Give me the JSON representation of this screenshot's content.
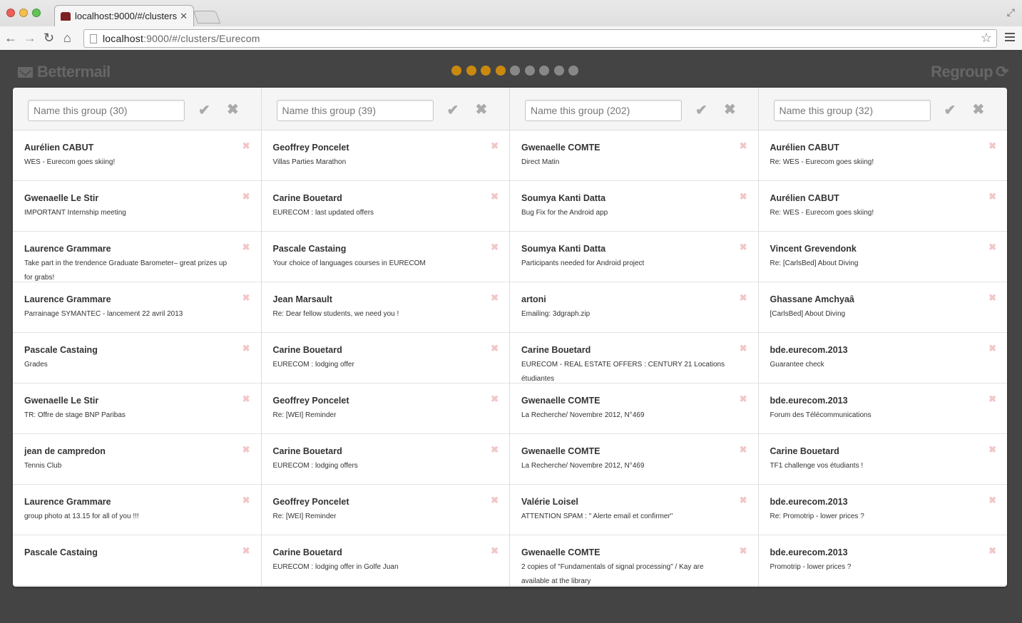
{
  "browser": {
    "tab_title": "localhost:9000/#/clusters/",
    "url_host": "localhost",
    "url_rest": ":9000/#/clusters/Eurecom"
  },
  "app": {
    "brand": "Bettermail",
    "regroup_label": "Regroup",
    "progress": {
      "total": 9,
      "active": 4
    }
  },
  "groups": [
    {
      "placeholder": "Name this group (30)",
      "mails": [
        {
          "sender": "Aurélien CABUT",
          "subject": "WES - Eurecom goes skiing!"
        },
        {
          "sender": "Gwenaelle Le Stir",
          "subject": "IMPORTANT Internship meeting"
        },
        {
          "sender": "Laurence Grammare",
          "subject": "Take part in the trendence Graduate Barometer– great prizes up for grabs!"
        },
        {
          "sender": "Laurence Grammare",
          "subject": "Parrainage SYMANTEC - lancement 22 avril 2013"
        },
        {
          "sender": "Pascale Castaing",
          "subject": "Grades"
        },
        {
          "sender": "Gwenaelle Le Stir",
          "subject": "TR: Offre de stage BNP Paribas"
        },
        {
          "sender": "jean de campredon",
          "subject": "Tennis Club"
        },
        {
          "sender": "Laurence Grammare",
          "subject": "group photo at 13.15 for all of you !!!"
        },
        {
          "sender": "Pascale Castaing",
          "subject": ""
        }
      ]
    },
    {
      "placeholder": "Name this group (39)",
      "mails": [
        {
          "sender": "Geoffrey Poncelet",
          "subject": "Villas Parties Marathon"
        },
        {
          "sender": "Carine Bouetard",
          "subject": "EURECOM : last updated offers"
        },
        {
          "sender": "Pascale Castaing",
          "subject": "Your choice of languages courses in EURECOM"
        },
        {
          "sender": "Jean Marsault",
          "subject": "Re: Dear fellow students, we need you !"
        },
        {
          "sender": "Carine Bouetard",
          "subject": "EURECOM  : lodging offer"
        },
        {
          "sender": "Geoffrey Poncelet",
          "subject": "Re: [WEI] Reminder"
        },
        {
          "sender": "Carine Bouetard",
          "subject": "EURECOM : lodging offers"
        },
        {
          "sender": "Geoffrey Poncelet",
          "subject": "Re: [WEI] Reminder"
        },
        {
          "sender": "Carine Bouetard",
          "subject": "EURECOM : lodging offer in Golfe Juan"
        }
      ]
    },
    {
      "placeholder": "Name this group (202)",
      "mails": [
        {
          "sender": "Gwenaelle COMTE",
          "subject": "Direct Matin"
        },
        {
          "sender": "Soumya Kanti Datta",
          "subject": "Bug Fix for the Android app"
        },
        {
          "sender": "Soumya Kanti Datta",
          "subject": "Participants needed for Android project"
        },
        {
          "sender": "artoni",
          "subject": "Emailing: 3dgraph.zip"
        },
        {
          "sender": "Carine Bouetard",
          "subject": "EURECOM - REAL ESTATE OFFERS : CENTURY 21 Locations étudiantes"
        },
        {
          "sender": "Gwenaelle COMTE",
          "subject": "La Recherche/ Novembre 2012, N°469"
        },
        {
          "sender": "Gwenaelle COMTE",
          "subject": "La Recherche/ Novembre 2012, N°469"
        },
        {
          "sender": "Valérie Loisel",
          "subject": "ATTENTION SPAM : \" Alerte email et confirmer\""
        },
        {
          "sender": "Gwenaelle COMTE",
          "subject": "2 copies of \"Fundamentals of signal processing\" / Kay are available at the library"
        }
      ]
    },
    {
      "placeholder": "Name this group (32)",
      "mails": [
        {
          "sender": "Aurélien CABUT",
          "subject": "Re: WES - Eurecom goes skiing!"
        },
        {
          "sender": "Aurélien CABUT",
          "subject": "Re: WES - Eurecom goes skiing!"
        },
        {
          "sender": "Vincent Grevendonk",
          "subject": "Re: [CarlsBed] About Diving"
        },
        {
          "sender": "Ghassane Amchyaâ",
          "subject": "[CarlsBed] About Diving"
        },
        {
          "sender": "bde.eurecom.2013",
          "subject": "Guarantee check"
        },
        {
          "sender": "bde.eurecom.2013",
          "subject": "Forum des Télécommunications"
        },
        {
          "sender": "Carine Bouetard",
          "subject": "TF1 challenge vos étudiants !"
        },
        {
          "sender": "bde.eurecom.2013",
          "subject": "Re: Promotrip - lower prices ?"
        },
        {
          "sender": "bde.eurecom.2013",
          "subject": "Promotrip - lower prices ?"
        }
      ]
    }
  ]
}
